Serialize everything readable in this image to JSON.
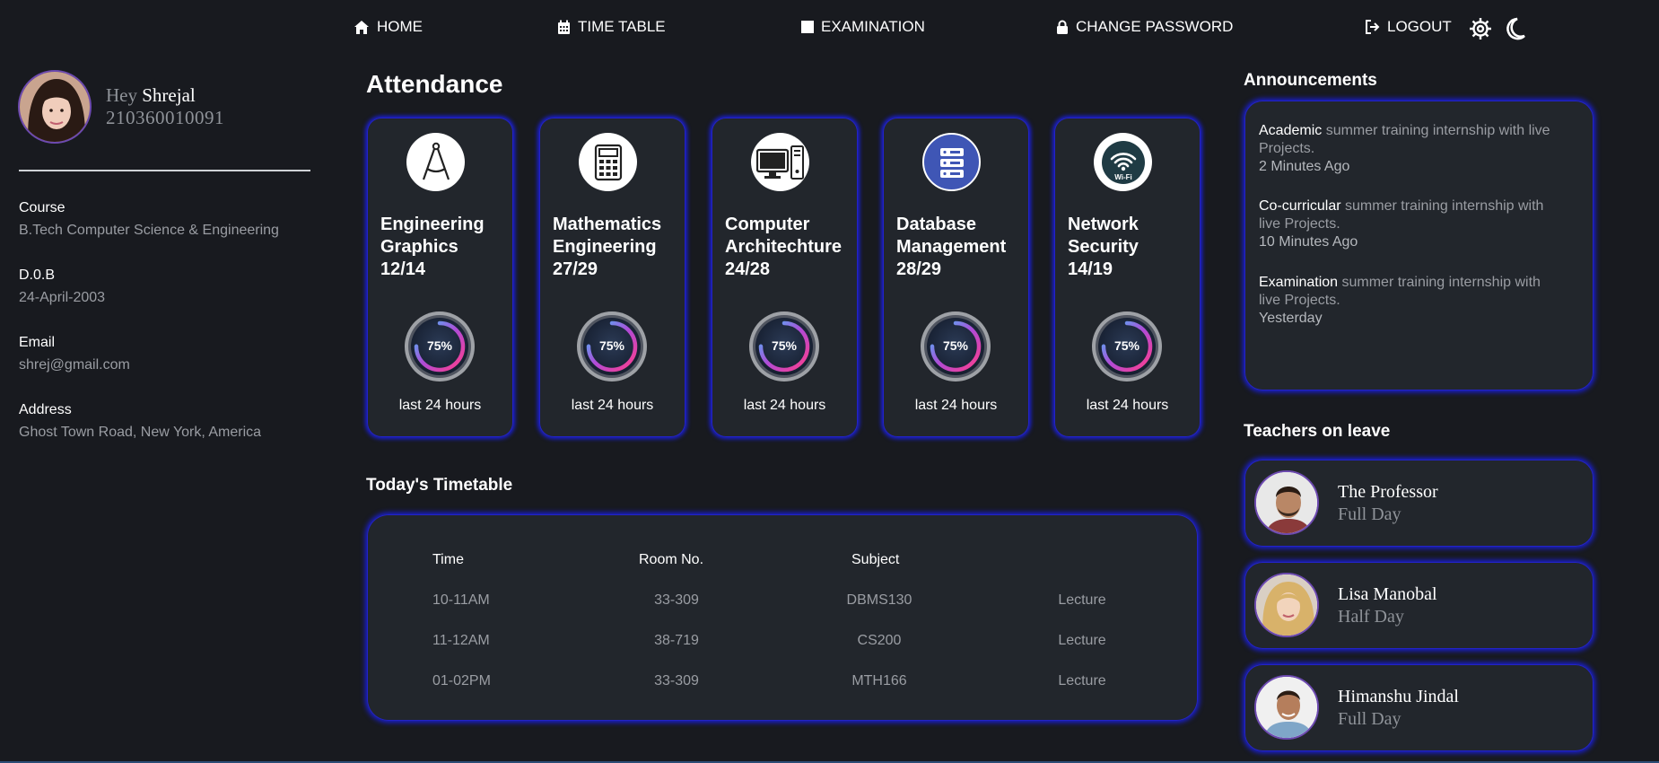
{
  "nav": {
    "home": "HOME",
    "timetable": "TIME TABLE",
    "examination": "EXAMINATION",
    "change_password": "CHANGE PASSWORD",
    "logout": "LOGOUT"
  },
  "profile": {
    "greeting": "Hey",
    "name": "Shrejal",
    "roll": "210360010091",
    "course_label": "Course",
    "course": "B.Tech Computer Science & Engineering",
    "dob_label": "D.0.B",
    "dob": "24-April-2003",
    "email_label": "Email",
    "email": "shrej@gmail.com",
    "address_label": "Address",
    "address": "Ghost Town Road, New York, America"
  },
  "attendance": {
    "title": "Attendance",
    "cards": [
      {
        "subject": "Engineering Graphics",
        "count": "12/14",
        "percent": "75%",
        "percent_value": 75,
        "footer": "last 24 hours",
        "icon": "compass-icon"
      },
      {
        "subject": "Mathematics Engineering",
        "count": "27/29",
        "percent": "75%",
        "percent_value": 75,
        "footer": "last 24 hours",
        "icon": "calculator-icon"
      },
      {
        "subject": "Computer Architechture",
        "count": "24/28",
        "percent": "75%",
        "percent_value": 75,
        "footer": "last 24 hours",
        "icon": "computer-icon"
      },
      {
        "subject": "Database Management",
        "count": "28/29",
        "percent": "75%",
        "percent_value": 75,
        "footer": "last 24 hours",
        "icon": "server-icon"
      },
      {
        "subject": "Network Security",
        "count": "14/19",
        "percent": "75%",
        "percent_value": 75,
        "footer": "last 24 hours",
        "icon": "wifi-icon"
      }
    ]
  },
  "timetable": {
    "title": "Today's Timetable",
    "headers": [
      "Time",
      "Room No.",
      "Subject"
    ],
    "rows": [
      [
        "10-11AM",
        "33-309",
        "DBMS130",
        "Lecture"
      ],
      [
        "11-12AM",
        "38-719",
        "CS200",
        "Lecture"
      ],
      [
        "01-02PM",
        "33-309",
        "MTH166",
        "Lecture"
      ]
    ]
  },
  "announcements": {
    "title": "Announcements",
    "items": [
      {
        "category": "Academic",
        "text": "summer training internship with live Projects.",
        "time": "2 Minutes Ago"
      },
      {
        "category": "Co-curricular",
        "text": "summer training internship with live Projects.",
        "time": "10 Minutes Ago"
      },
      {
        "category": "Examination",
        "text": "summer training internship with live Projects.",
        "time": "Yesterday"
      }
    ]
  },
  "teachers_on_leave": {
    "title": "Teachers on leave",
    "items": [
      {
        "name": "The Professor",
        "duration": "Full Day"
      },
      {
        "name": "Lisa Manobal",
        "duration": "Half Day"
      },
      {
        "name": "Himanshu Jindal",
        "duration": "Full Day"
      }
    ]
  },
  "colors": {
    "background": "#181a1f",
    "card": "#22262c",
    "glow": "#1a1fd8",
    "muted_text": "#9a9da3"
  }
}
